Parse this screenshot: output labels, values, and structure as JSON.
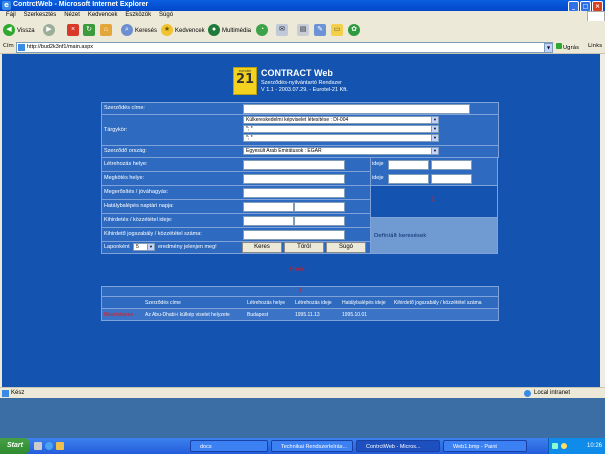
{
  "window": {
    "title": "ContrctWeb - Microsoft Internet Explorer",
    "min": "_",
    "max": "□",
    "close": "×"
  },
  "menu": [
    "Fájl",
    "Szerkesztés",
    "Nézet",
    "Kedvencek",
    "Eszközök",
    "Súgó"
  ],
  "toolbar": {
    "back": "Vissza",
    "search": "Keresés",
    "favorites": "Kedvencek",
    "multimedia": "Multimédia"
  },
  "address": {
    "label": "Cím",
    "url": "http://bud2k3nf1/main.aspx",
    "go": "Ugrás",
    "links": "Links"
  },
  "app": {
    "logo_top": "eurotel",
    "logo_num": "21",
    "title": "CONTRACT Web",
    "subtitle": "Szerződés-nyilvántartó Rendszer",
    "version": "V 1.1 - 2003.07.29. - Eurotel-21 Kft."
  },
  "form": {
    "contract_title_label": "Szerződés címe:",
    "subject_label": "Tárgykör:",
    "subject_values": [
      "Külkereskedelmi képviselet létesítése : DI-004",
      "*; *",
      "*; *"
    ],
    "country_label": "Szerződő ország:",
    "country_value": "Egyesült Arab Emirátusok : EGAR",
    "created_place_label": "Létrehozás helye:",
    "signed_place_label": "Megkötés helye:",
    "ratified_label": "Megerősítés / jóváhagyás:",
    "effective_label": "Hatálybalépés naptári napja:",
    "published_date_label": "Kihirdetés / közzététel ideje:",
    "published_law_label": "Kihirdető jogszabály / közzététel száma:",
    "time_label": "ideje",
    "side_count": "1",
    "side_defined_label": "Definiált keresések",
    "per_page_prefix": "Laponként",
    "per_page_value": "5",
    "per_page_suffix": "eredmény jelenjen meg!",
    "search_button": "Keres",
    "delete_button": "Töröl",
    "help_button": "Súgó"
  },
  "results": {
    "count_label": "Hírek",
    "page_num": "1",
    "headers": [
      "",
      "Szerződés címe",
      "Létrehozás helye",
      "Létrehozás ideje",
      "Hatálybalépés ideje",
      "Kihirdető jogszabály / közzététel száma"
    ],
    "rows": [
      [
        "Részletezés",
        "Az Abu-Dhabi-i külkép viselet helyzete",
        "Budapest",
        "1995.11.13",
        "1995.10.01",
        ""
      ]
    ]
  },
  "status": {
    "text": "Kész",
    "zone": "Local intranet"
  },
  "taskbar": {
    "start": "Start",
    "tasks": [
      "docs",
      "Technikai Rendszerleírás...",
      "ContrctWeb - Micros...",
      "Web1.bmp - Paint"
    ],
    "time": "10:26"
  },
  "colors": {
    "page_bg": "#1454B0",
    "row_bg": "#2E6BC0",
    "accent_red": "#E01818",
    "logo_yellow": "#F4D320"
  }
}
